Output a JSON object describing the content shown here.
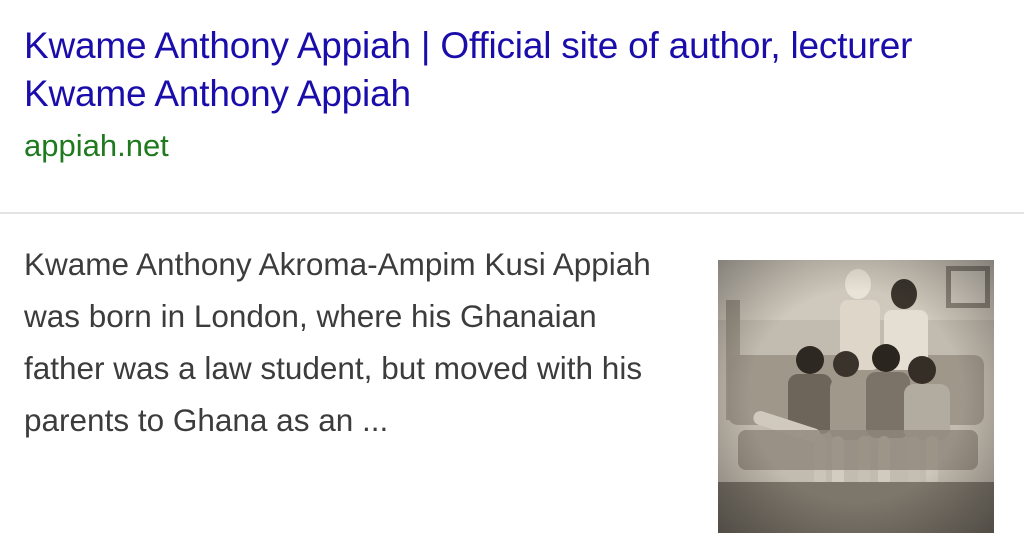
{
  "result": {
    "title": "Kwame Anthony Appiah | Official site of author, lecturer Kwame Anthony Appiah",
    "url": "appiah.net",
    "snippet": "Kwame Anthony Akroma-Ampim Kusi Appiah was born in London, where his Ghanaian father was a law student, but moved with his parents to Ghana as an ..."
  },
  "colors": {
    "title": "#1a0dab",
    "url": "#1f7a1f",
    "snippet": "#3c3c3c",
    "divider": "#e4e4e4"
  }
}
